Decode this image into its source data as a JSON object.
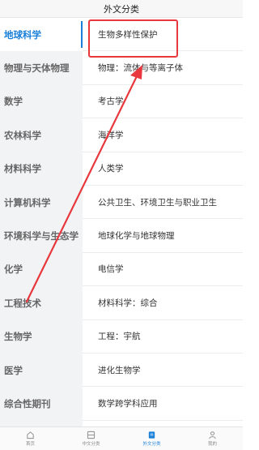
{
  "header": {
    "title": "外文分类"
  },
  "sidebar": {
    "items": [
      {
        "label": "地球科学",
        "active": true
      },
      {
        "label": "物理与天体物理"
      },
      {
        "label": "数学"
      },
      {
        "label": "农林科学"
      },
      {
        "label": "材料科学"
      },
      {
        "label": "计算机科学"
      },
      {
        "label": "环境科学与生态学"
      },
      {
        "label": "化学"
      },
      {
        "label": "工程技术"
      },
      {
        "label": "生物学"
      },
      {
        "label": "医学"
      },
      {
        "label": "综合性期刊"
      }
    ]
  },
  "content": {
    "items": [
      {
        "label": "生物多样性保护"
      },
      {
        "label": "物理：流体与等离子体"
      },
      {
        "label": "考古学"
      },
      {
        "label": "海洋学"
      },
      {
        "label": "人类学"
      },
      {
        "label": "公共卫生、环境卫生与职业卫生"
      },
      {
        "label": "地球化学与地球物理"
      },
      {
        "label": "电信学"
      },
      {
        "label": "材料科学：综合"
      },
      {
        "label": "工程：宇航"
      },
      {
        "label": "进化生物学"
      },
      {
        "label": "数学跨学科应用"
      }
    ]
  },
  "tabbar": {
    "items": [
      {
        "label": "首页",
        "icon": "home-icon"
      },
      {
        "label": "中文分类",
        "icon": "grid-icon"
      },
      {
        "label": "外文分类",
        "icon": "book-icon",
        "active": true
      },
      {
        "label": "我的",
        "icon": "user-icon"
      }
    ]
  },
  "annotation": {
    "color": "#e8383d"
  },
  "colors": {
    "accent": "#1a7fd8"
  }
}
